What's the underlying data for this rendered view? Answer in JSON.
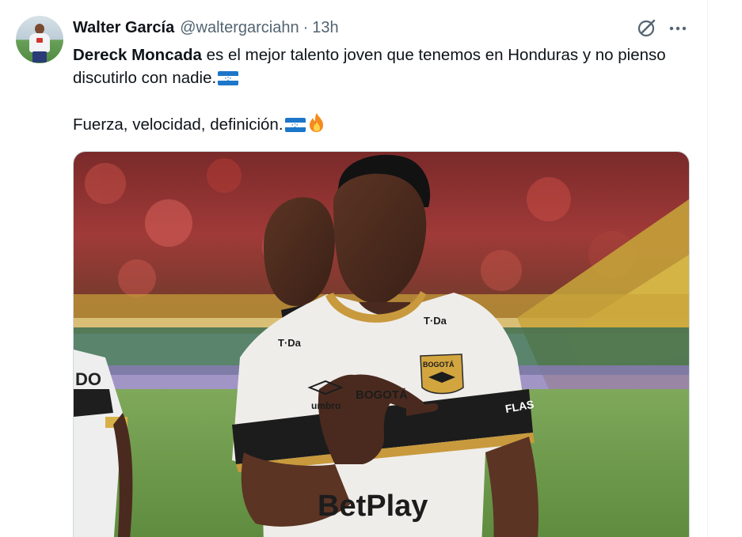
{
  "tweet": {
    "author_name": "Walter García",
    "author_handle": "@waltergarciahn",
    "separator": "·",
    "time": "13h",
    "mention": "Dereck Moncada",
    "line1_rest": " es el mejor talento joven que tenemos en Honduras y no pienso discutirlo con nadie.",
    "line2": "Fuerza, velocidad, definición."
  },
  "icons": {
    "avatar": "avatar",
    "grok": "grok-icon",
    "more": "more-icon",
    "flag": "honduras-flag-icon",
    "fire": "fire-icon"
  },
  "media": {
    "jersey_sponsor": "BetPlay",
    "jersey_brand_left": "T·Da",
    "jersey_brand_right": "T·Da",
    "jersey_city": "BOGOTÁ",
    "jersey_maker": "umbro",
    "jersey_crest_text": "BOGOTÁ",
    "sleeve_sponsor": "FLAS",
    "left_player_text": "DO"
  },
  "colors": {
    "text": "#0f1419",
    "secondary": "#536471",
    "border": "#cfd9de",
    "flag_blue": "#1c76c9"
  }
}
